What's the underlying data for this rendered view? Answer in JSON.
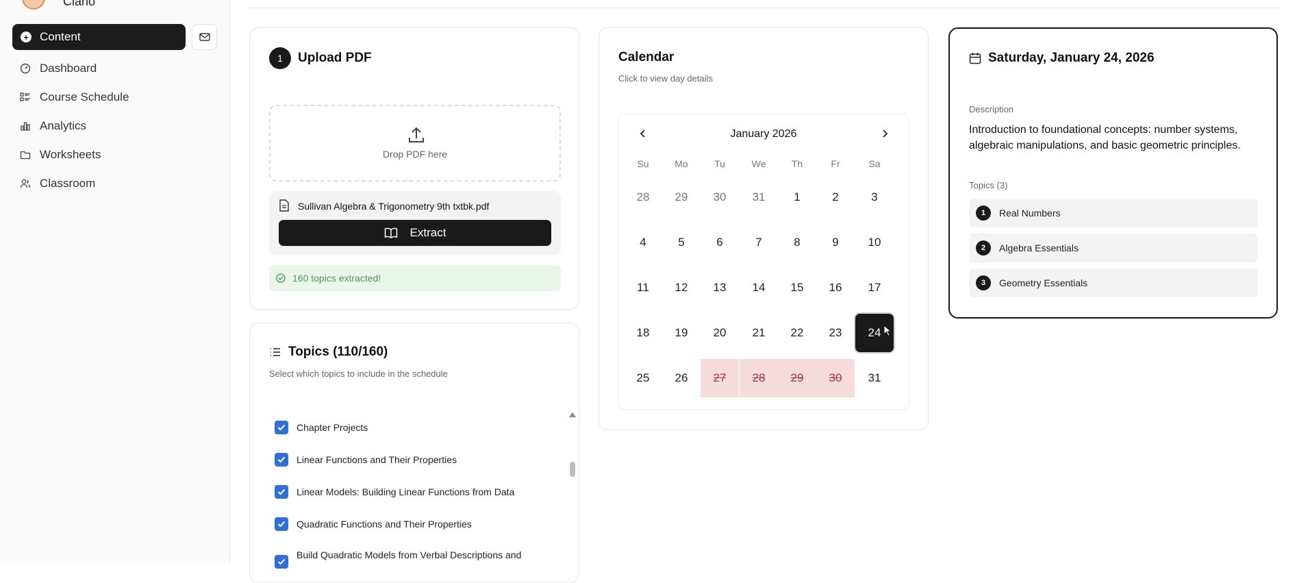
{
  "user": {
    "name": "Clario"
  },
  "sidebar": {
    "active": "Content",
    "items": [
      {
        "label": "Dashboard",
        "icon": "gauge-icon"
      },
      {
        "label": "Course Schedule",
        "icon": "list-icon"
      },
      {
        "label": "Analytics",
        "icon": "bar-chart-icon"
      },
      {
        "label": "Worksheets",
        "icon": "folder-icon"
      },
      {
        "label": "Classroom",
        "icon": "users-icon"
      }
    ]
  },
  "upload": {
    "step": "1",
    "title": "Upload PDF",
    "drop_text": "Drop PDF here",
    "filename": "Sullivan Algebra & Trigonometry 9th txtbk.pdf",
    "extract_label": "Extract",
    "success": "160 topics extracted!"
  },
  "topics": {
    "title": "Topics (110/160)",
    "subtitle": "Select which topics to include in the schedule",
    "items": [
      "Chapter Projects",
      "Linear Functions and Their Properties",
      "Linear Models: Building Linear Functions from Data",
      "Quadratic Functions and Their Properties",
      "Build Quadratic Models from Verbal Descriptions and"
    ]
  },
  "calendar": {
    "title": "Calendar",
    "subtitle": "Click to view day details",
    "month": "January 2026",
    "weekdays": [
      "Su",
      "Mo",
      "Tu",
      "We",
      "Th",
      "Fr",
      "Sa"
    ],
    "weeks": [
      [
        "28",
        "29",
        "30",
        "31",
        "1",
        "2",
        "3"
      ],
      [
        "4",
        "5",
        "6",
        "7",
        "8",
        "9",
        "10"
      ],
      [
        "11",
        "12",
        "13",
        "14",
        "15",
        "16",
        "17"
      ],
      [
        "18",
        "19",
        "20",
        "21",
        "22",
        "23",
        "24"
      ],
      [
        "25",
        "26",
        "27",
        "28",
        "29",
        "30",
        "31"
      ]
    ],
    "selected": "24",
    "blocked": [
      "27",
      "28",
      "29",
      "30"
    ]
  },
  "day_detail": {
    "title": "Saturday, January 24, 2026",
    "description_label": "Description",
    "description": "Introduction to foundational concepts: number systems, algebraic manipulations, and basic geometric principles.",
    "topics_label": "Topics (3)",
    "topics": [
      {
        "num": "1",
        "label": "Real Numbers"
      },
      {
        "num": "2",
        "label": "Algebra Essentials"
      },
      {
        "num": "3",
        "label": "Geometry Essentials"
      }
    ]
  }
}
